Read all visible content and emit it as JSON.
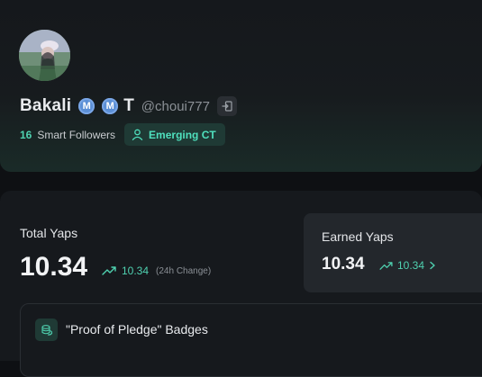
{
  "profile": {
    "display_name": "Bakali",
    "badge_letter": "M",
    "badge_letter_2": "M",
    "extra_letter": "T",
    "handle": "@choui777",
    "smart_followers_count": "16",
    "smart_followers_label": "Smart Followers",
    "status_pill": "Emerging CT"
  },
  "yaps": {
    "total_label": "Total Yaps",
    "total_value": "10.34",
    "change_value": "10.34",
    "change_label": "(24h Change)",
    "earned_label": "Earned Yaps",
    "earned_value": "10.34",
    "earned_change": "10.34"
  },
  "badges": {
    "title": "\"Proof of Pledge\" Badges"
  },
  "colors": {
    "accent": "#4fd1b0",
    "badge_blue": "#5b8fd6",
    "background": "#0e1013"
  },
  "icons": [
    "logout-icon",
    "user-icon",
    "trend-up-icon",
    "chevron-right-icon",
    "coins-icon",
    "m-badge-icon"
  ]
}
